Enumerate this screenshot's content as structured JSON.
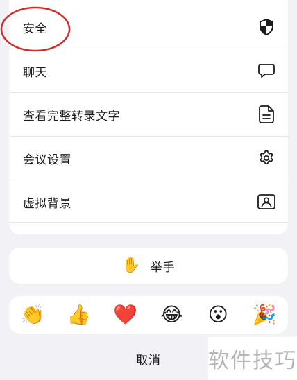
{
  "menu": {
    "items": [
      {
        "label": "安全",
        "icon": "shield-icon"
      },
      {
        "label": "聊天",
        "icon": "chat-bubble-icon"
      },
      {
        "label": "查看完整转录文字",
        "icon": "document-icon"
      },
      {
        "label": "会议设置",
        "icon": "gear-icon"
      },
      {
        "label": "虚拟背景",
        "icon": "portrait-frame-icon"
      }
    ]
  },
  "raise_hand": {
    "label": "举手",
    "emoji": "✋"
  },
  "reactions": [
    {
      "emoji": "👏",
      "name": "clap"
    },
    {
      "emoji": "👍",
      "name": "thumbs-up"
    },
    {
      "emoji": "❤️",
      "name": "heart"
    },
    {
      "emoji": "😂",
      "name": "tears-of-joy"
    },
    {
      "emoji": "😮",
      "name": "surprised"
    },
    {
      "emoji": "🎉",
      "name": "party-popper"
    }
  ],
  "cancel_label": "取消",
  "watermark": "软件技巧",
  "colors": {
    "annotation": "#d42a2a",
    "background": "#f2f2f6",
    "card": "#ffffff",
    "divider": "#e6e6ea"
  }
}
